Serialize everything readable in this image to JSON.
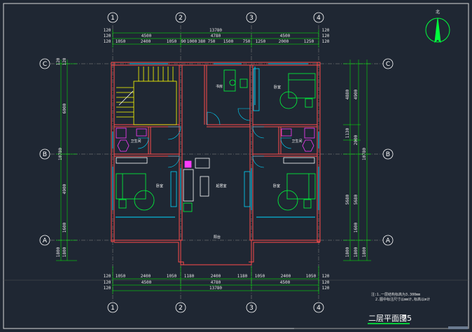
{
  "drawing": {
    "title": "二层平面图",
    "scale": "75",
    "north_label": "北",
    "notes": [
      "注:1.一层结构标高为3.300mm",
      "2.图中标注尺寸以mm计,标高以m计"
    ]
  },
  "axes": {
    "columns": [
      "1",
      "2",
      "3",
      "4"
    ],
    "rows": [
      "C",
      "B",
      "A"
    ]
  },
  "dimensions": {
    "top_overall": "13780",
    "top_mid": [
      "4500",
      "4780",
      "4500"
    ],
    "top_detail": [
      "1050",
      "2400",
      "1050",
      "90",
      "1000",
      "380",
      "750",
      "1500",
      "750",
      "1250",
      "2000",
      "1250"
    ],
    "bottom_overall": "13780",
    "bottom_mid": [
      "4500",
      "4780",
      "4500"
    ],
    "bottom_detail": [
      "1050",
      "2400",
      "1050",
      "1180",
      "2400",
      "1180",
      "1050",
      "2400",
      "1050"
    ],
    "edge": "120",
    "left_overall": "10780",
    "left_parts": [
      "6000",
      "4900",
      "1600",
      "1800"
    ],
    "right_overall": "10780",
    "right_parts": [
      "4880",
      "4900",
      "2000",
      "1130",
      "5680",
      "1600",
      "1800"
    ]
  },
  "rooms": {
    "study": "书房",
    "bedroom_ne": "卧室",
    "bedroom_sw": "卧室",
    "bedroom_se": "卧室",
    "bathroom_w": "卫生间",
    "bathroom_e": "卫生间",
    "living": "起居室",
    "terrace": "阳台"
  },
  "colors": {
    "background": "#1f2733",
    "wall": "#ff4b4b",
    "furniture": "#00ff3c",
    "window": "#00d7ff",
    "stair": "#ffff00",
    "dim": "#00ff00",
    "fixture": "#ff3cff",
    "axis": "#ffffff"
  }
}
